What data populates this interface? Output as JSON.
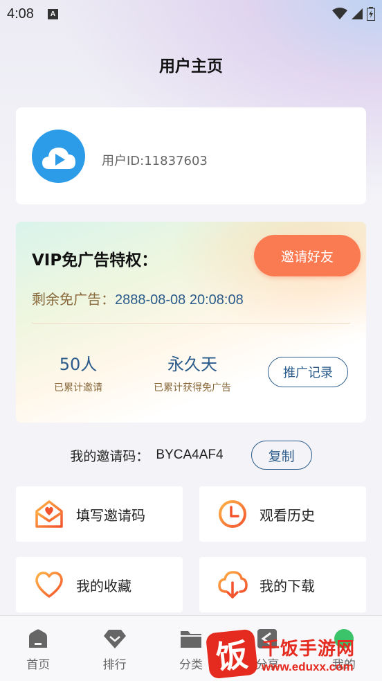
{
  "status_bar": {
    "time": "4:08",
    "notification_badge": "A"
  },
  "page": {
    "title": "用户主页"
  },
  "profile": {
    "user_id": "用户ID:11837603",
    "avatar_icon": "cloud-play-icon"
  },
  "vip": {
    "title": "VIP免广告特权：",
    "invite_button": "邀请好友",
    "remaining_label": "剩余免广告：",
    "remaining_date": "2888-08-08 20:08:08",
    "stats": [
      {
        "value": "50人",
        "label": "已累计邀请"
      },
      {
        "value": "永久天",
        "label": "已累计获得免广告"
      }
    ],
    "promo_button": "推广记录"
  },
  "invite_code": {
    "label": "我的邀请码：",
    "value": "BYCA4AF4",
    "copy_button": "复制"
  },
  "tiles": [
    {
      "label": "填写邀请码",
      "icon": "envelope-heart-icon"
    },
    {
      "label": "观看历史",
      "icon": "clock-icon"
    },
    {
      "label": "我的收藏",
      "icon": "heart-icon"
    },
    {
      "label": "我的下载",
      "icon": "cloud-download-icon"
    }
  ],
  "bottom_nav": [
    {
      "label": "首页",
      "icon": "home-icon"
    },
    {
      "label": "排行",
      "icon": "diamond-icon"
    },
    {
      "label": "分类",
      "icon": "folder-icon"
    },
    {
      "label": "分享",
      "icon": "share-icon"
    },
    {
      "label": "我的",
      "icon": "user-icon"
    }
  ],
  "watermark": {
    "seal": "饭",
    "title": "千饭手游网",
    "url": "www.eduxx.com"
  },
  "colors": {
    "accent_orange": "#fa7a52",
    "text_blue": "#2a5b8a",
    "avatar_blue": "#2c9be8"
  }
}
